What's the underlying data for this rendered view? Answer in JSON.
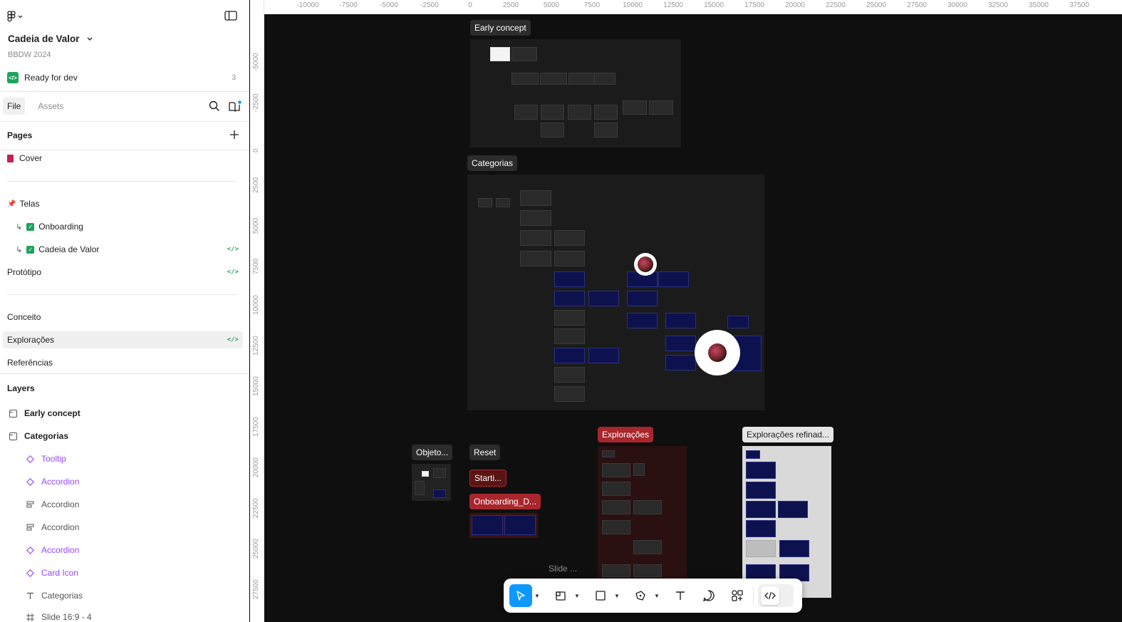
{
  "file": {
    "title": "Cadeia de Valor",
    "subtitle": "BBDW 2024",
    "status_label": "Ready for dev",
    "status_count": "3"
  },
  "tabs": {
    "file": "File",
    "assets": "Assets"
  },
  "pages": {
    "title": "Pages",
    "items": [
      {
        "label": "Cover"
      },
      {
        "label": "Telas"
      },
      {
        "label": "Onboarding"
      },
      {
        "label": "Cadeia de Valor"
      },
      {
        "label": "Protótipo"
      },
      {
        "label": "Conceito"
      },
      {
        "label": "Explorações"
      },
      {
        "label": "Referências"
      }
    ]
  },
  "layers": {
    "title": "Layers",
    "items": [
      {
        "label": "Early concept"
      },
      {
        "label": "Categorias"
      },
      {
        "label": "Tooltip"
      },
      {
        "label": "Accordion"
      },
      {
        "label": "Accordion"
      },
      {
        "label": "Accordion"
      },
      {
        "label": "Accordion"
      },
      {
        "label": "Card Icon"
      },
      {
        "label": "Categorias"
      },
      {
        "label": "Slide 16:9 - 4"
      }
    ]
  },
  "ruler": {
    "top": [
      "-10000",
      "-7500",
      "-5000",
      "-2500",
      "0",
      "2500",
      "5000",
      "7500",
      "10000",
      "12500",
      "15000",
      "17500",
      "20000",
      "22500",
      "25000",
      "27500",
      "30000",
      "32500",
      "35000",
      "37500"
    ],
    "left": [
      "-5000",
      "-2500",
      "0",
      "2500",
      "5000",
      "7500",
      "10000",
      "12500",
      "15000",
      "17500",
      "20000",
      "22500",
      "25000",
      "27500"
    ]
  },
  "canvas": {
    "frames": {
      "early_concept": "Early concept",
      "categorias": "Categorias",
      "objeto": "Objeto...",
      "reset": "Reset",
      "starti": "Starti...",
      "onboarding_d": "Onboarding_D...",
      "exploracoes": "Explorações",
      "exploracoes_refinad": "Explorações refinad...",
      "slide": "Slide ..."
    }
  },
  "colors": {
    "accent": "#0d99ff",
    "dev_green": "#1fa35c",
    "component_purple": "#9747ff",
    "cover_swatch": "#c9204f"
  },
  "icons": {
    "figma_menu": "figma-logo-icon",
    "panel": "sidebar-toggle-icon",
    "search": "search-icon",
    "library": "library-book-icon"
  }
}
